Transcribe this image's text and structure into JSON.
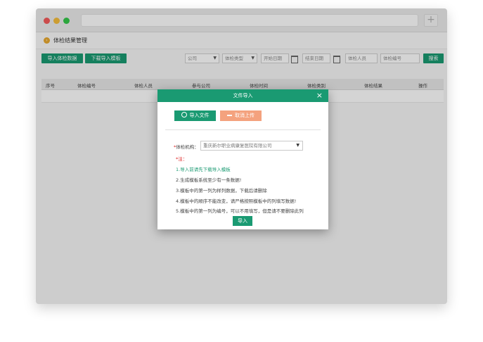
{
  "page": {
    "title": "体检结果管理"
  },
  "toolbar": {
    "import_data_label": "导入体检数据",
    "download_template_label": "下载导入模板",
    "company_select": "公司",
    "exam_type_select": "体检类型",
    "start_date_placeholder": "开始日期",
    "end_date_placeholder": "结束日期",
    "examinee_placeholder": "体检人员",
    "exam_no_placeholder": "体检编号",
    "search_label": "搜索"
  },
  "table": {
    "columns": [
      "序号",
      "体检编号",
      "体检人员",
      "参与公司",
      "体检时间",
      "体检类别",
      "体检结果",
      "操作"
    ]
  },
  "dialog": {
    "title": "文件导入",
    "close": "×",
    "import_file_label": "导入文件",
    "cancel_upload_label": "取消上传",
    "org_label": "体检机构：",
    "org_required": "*",
    "org_value": "重庆新尔职业病康复医院有限公司",
    "note_title": "*注：",
    "notes": [
      "1.导入前请先下载导入模板",
      "2.生成模板系统至少有一条数据!",
      "3.模板中的第一列为样列数据，下载后请删除",
      "4.模板中的顺序不能改变，请严格按照模板中的列填写数据!",
      "5.模板中的第一列为编号，可以不用填写，但是请不要删除此列"
    ],
    "import_label": "导入"
  },
  "colors": {
    "accent": "#1a9a72",
    "cancel": "#f4a27e",
    "required": "#dd2222"
  },
  "icons": {
    "header": "chevron-circle-icon",
    "upload": "upload-circle-icon",
    "cancel": "cancel-icon",
    "calendar": "calendar-icon"
  }
}
